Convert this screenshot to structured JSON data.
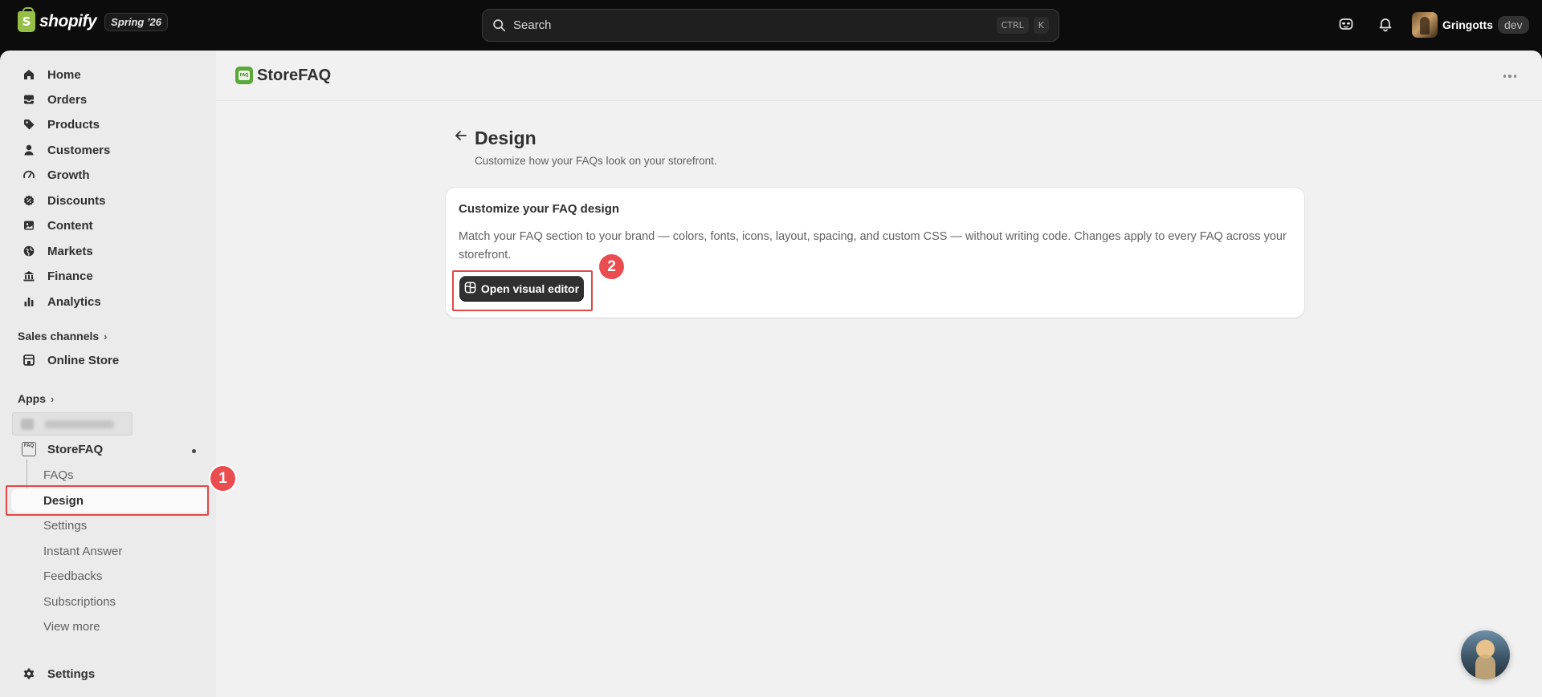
{
  "topbar": {
    "brand": "shopify",
    "edition": "Spring ’26",
    "search_placeholder": "Search",
    "shortcut_keys": [
      "CTRL",
      "K"
    ],
    "account_name": "Gringotts",
    "account_badge": "dev"
  },
  "sidebar": {
    "nav": [
      {
        "label": "Home",
        "icon": "home-icon"
      },
      {
        "label": "Orders",
        "icon": "inbox-icon"
      },
      {
        "label": "Products",
        "icon": "tag-icon"
      },
      {
        "label": "Customers",
        "icon": "person-icon"
      },
      {
        "label": "Growth",
        "icon": "gauge-icon"
      },
      {
        "label": "Discounts",
        "icon": "discount-icon"
      },
      {
        "label": "Content",
        "icon": "image-icon"
      },
      {
        "label": "Markets",
        "icon": "globe-icon"
      },
      {
        "label": "Finance",
        "icon": "bank-icon"
      },
      {
        "label": "Analytics",
        "icon": "bar-chart-icon"
      }
    ],
    "sales_channels_label": "Sales channels",
    "online_store_label": "Online Store",
    "apps_label": "Apps",
    "app_name": "StoreFAQ",
    "app_subitems": [
      "FAQs",
      "Design",
      "Settings",
      "Instant Answer",
      "Feedbacks",
      "Subscriptions",
      "View more"
    ],
    "active_subitem": "Design",
    "settings_label": "Settings"
  },
  "main": {
    "app_title": "StoreFAQ",
    "app_logo_text": "FAQ",
    "page_title": "Design",
    "page_subtitle": "Customize how your FAQs look on your storefront.",
    "card": {
      "title": "Customize your FAQ design",
      "body": "Match your FAQ section to your brand — colors, fonts, icons, layout, spacing, and custom CSS — without writing code. Changes apply to every FAQ across your storefront.",
      "button_label": "Open visual editor"
    }
  },
  "annotations": {
    "step_1": "1",
    "step_2": "2",
    "highlight_color": "#e2474a"
  },
  "colors": {
    "topbar_bg": "#0c0c0c",
    "sidebar_bg": "#ebebeb",
    "main_bg": "#f1f1f1",
    "primary_button": "#303030",
    "badge_red": "#ea4d4f"
  }
}
